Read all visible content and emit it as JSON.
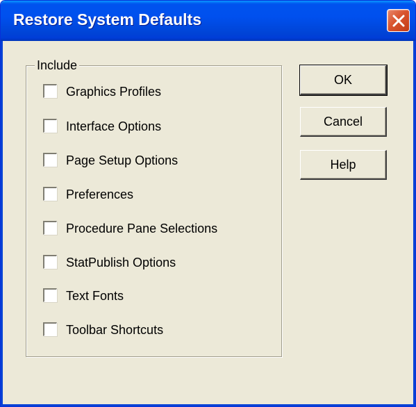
{
  "window": {
    "title": "Restore System Defaults",
    "title_color": "#ffffff",
    "titlebar_color": "#0050ee",
    "close_button_color": "#d9542f"
  },
  "group": {
    "label": "Include",
    "options": [
      {
        "label": "Graphics Profiles",
        "checked": false
      },
      {
        "label": "Interface Options",
        "checked": false
      },
      {
        "label": "Page Setup Options",
        "checked": false
      },
      {
        "label": "Preferences",
        "checked": false
      },
      {
        "label": "Procedure Pane Selections",
        "checked": false
      },
      {
        "label": "StatPublish Options",
        "checked": false
      },
      {
        "label": "Text Fonts",
        "checked": false
      },
      {
        "label": "Toolbar Shortcuts",
        "checked": false
      }
    ]
  },
  "buttons": {
    "ok": "OK",
    "cancel": "Cancel",
    "help": "Help"
  },
  "icons": {
    "close": "close-icon"
  }
}
